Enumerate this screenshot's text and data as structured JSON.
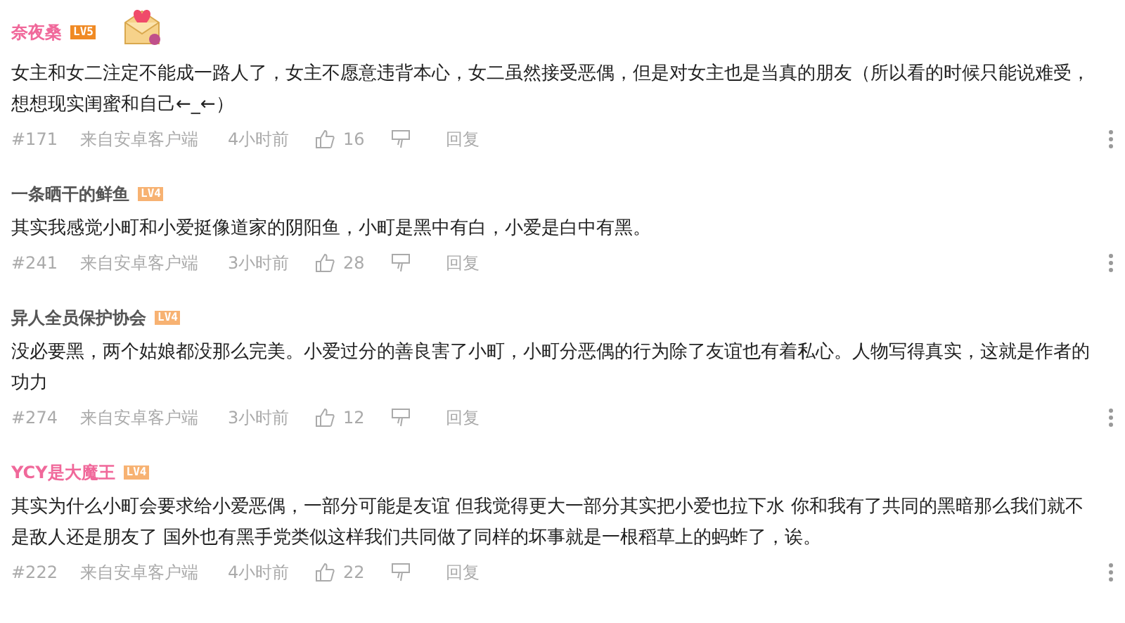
{
  "comments": [
    {
      "user": {
        "name": "奈夜桑",
        "color": "#f0689a"
      },
      "badge": {
        "label": "LV5",
        "color": "#f08a24"
      },
      "decoration": true,
      "text": "女主和女二注定不能成一路人了，女主不愿意违背本心，女二虽然接受恶偶，但是对女主也是当真的朋友（所以看的时候只能说难受，想想现实闺蜜和自己←_←）",
      "floor": "#171",
      "source": "来自安卓客户端",
      "time": "4小时前",
      "likes": "16",
      "reply": "回复"
    },
    {
      "user": {
        "name": "一条晒干的鲜鱼",
        "color": "#555555"
      },
      "badge": {
        "label": "LV4",
        "color": "#f7b272"
      },
      "decoration": false,
      "text": "其实我感觉小町和小爱挺像道家的阴阳鱼，小町是黑中有白，小爱是白中有黑。",
      "floor": "#241",
      "source": "来自安卓客户端",
      "time": "3小时前",
      "likes": "28",
      "reply": "回复"
    },
    {
      "user": {
        "name": "异人全员保护协会",
        "color": "#555555"
      },
      "badge": {
        "label": "LV4",
        "color": "#f7b272"
      },
      "decoration": false,
      "text": "没必要黑，两个姑娘都没那么完美。小爱过分的善良害了小町，小町分恶偶的行为除了友谊也有着私心。人物写得真实，这就是作者的功力",
      "floor": "#274",
      "source": "来自安卓客户端",
      "time": "3小时前",
      "likes": "12",
      "reply": "回复"
    },
    {
      "user": {
        "name": "YCY是大魔王",
        "color": "#f0689a"
      },
      "badge": {
        "label": "LV4",
        "color": "#f7b272"
      },
      "decoration": false,
      "text": "其实为什么小町会要求给小爱恶偶，一部分可能是友谊 但我觉得更大一部分其实把小爱也拉下水 你和我有了共同的黑暗那么我们就不是敌人还是朋友了 国外也有黑手党类似这样我们共同做了同样的坏事就是一根稻草上的蚂蚱了，诶。",
      "floor": "#222",
      "source": "来自安卓客户端",
      "time": "4小时前",
      "likes": "22",
      "reply": "回复"
    }
  ]
}
